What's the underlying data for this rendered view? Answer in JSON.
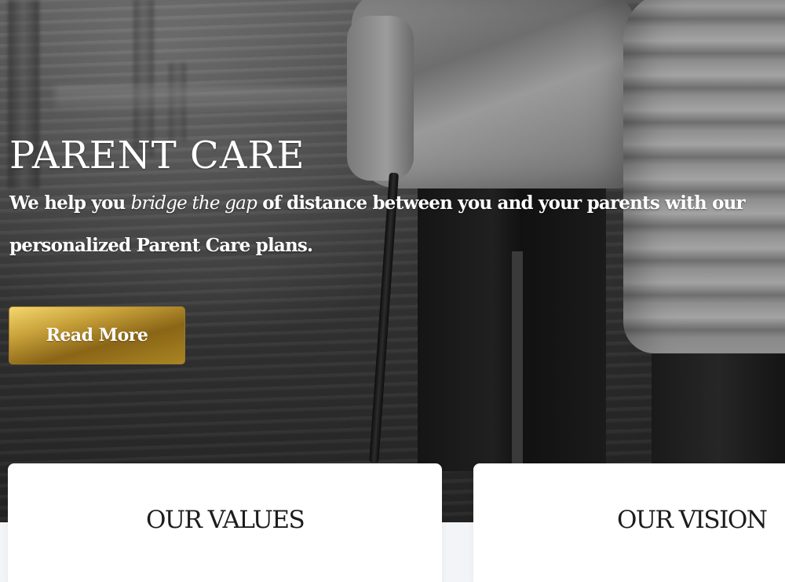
{
  "hero": {
    "title": "PARENT CARE",
    "subtitle_before": "We help you ",
    "subtitle_emphasis": "bridge the gap",
    "subtitle_after": " of distance between you and your parents with our personalized Parent Care plans.",
    "button_label": "Read More"
  },
  "cards": [
    {
      "title": "OUR VALUES"
    },
    {
      "title": "OUR VISION"
    }
  ],
  "colors": {
    "button_gold_light": "#f4d76d",
    "button_gold_dark": "#8a6516",
    "hero_text": "#ffffff",
    "card_background": "#ffffff",
    "card_title": "#1c1c1c"
  }
}
